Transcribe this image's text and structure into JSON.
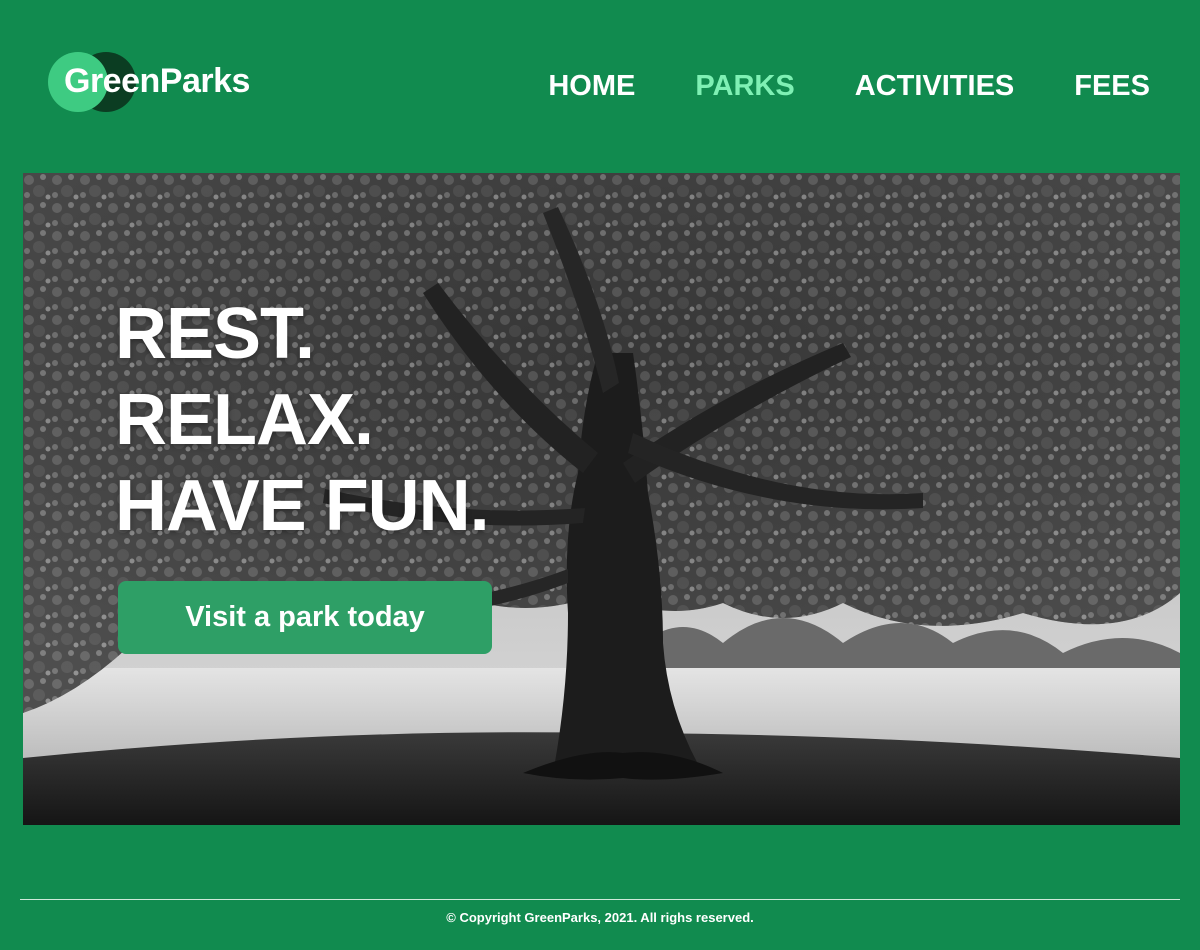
{
  "brand": {
    "name": "GreenParks"
  },
  "nav": {
    "items": [
      {
        "label": "HOME",
        "active": false
      },
      {
        "label": "PARKS",
        "active": true
      },
      {
        "label": "ACTIVITIES",
        "active": false
      },
      {
        "label": "FEES",
        "active": false
      }
    ]
  },
  "hero": {
    "headline": [
      "REST.",
      "RELAX.",
      "HAVE FUN."
    ],
    "cta_label": "Visit a park today",
    "image": "black-and-white-tree-in-park"
  },
  "footer": {
    "copyright": "© Copyright GreenParks, 2021. All righs reserved."
  },
  "colors": {
    "background": "#118b4f",
    "nav_active": "#7ff0b4",
    "cta": "#2e9f66",
    "logo_light": "#3ecb82",
    "logo_dark": "#0b3d22"
  }
}
